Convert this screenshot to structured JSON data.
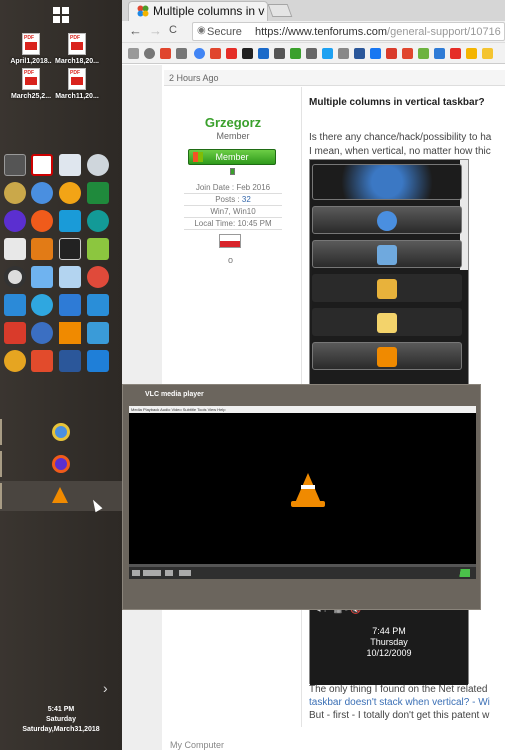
{
  "desktop": {
    "files": [
      {
        "label": "April1,2018..",
        "icon": "pdf-icon"
      },
      {
        "label": "March18,20...",
        "icon": "pdf-icon"
      },
      {
        "label": "March25,2...",
        "icon": "pdf-icon"
      },
      {
        "label": "March11,20...",
        "icon": "pdf-icon"
      }
    ]
  },
  "taskbar": {
    "clock_time": "5:41 PM",
    "clock_day": "Saturday",
    "clock_date": "Saturday,March31,2018",
    "expand_glyph": "›"
  },
  "browser": {
    "tab_title": "Multiple columns in vertical taskbar",
    "secure_label": "Secure",
    "url_host": "https://www.tenforums.com",
    "url_path": "/general-support/10716",
    "nav_back": "←",
    "nav_forward": "→",
    "nav_reload": "C",
    "nav_home": "⌂"
  },
  "post": {
    "time_ago": "2 Hours Ago",
    "user": {
      "name": "Grzegorz",
      "role": "Member",
      "badge": "Member",
      "join_date": "Join Date : Feb 2016",
      "posts_label": "Posts :",
      "posts_count": "32",
      "os": "Win7, Win10",
      "local_time": "Local Time: 10:45 PM",
      "dot": "o"
    },
    "title": "Multiple columns in vertical taskbar?",
    "line1": "Is there any chance/hack/possibility to ha",
    "line2": "I mean, when vertical, no matter how thic",
    "shot_time": "7:44 PM",
    "shot_day": "Thursday",
    "shot_date": "10/12/2009",
    "line3": "The only thing I found on the Net related",
    "line4_link": "taskbar doesn't stack when vertical? - Wi",
    "line5": "But - first - I totally don't get this patent w",
    "my_computer": "My Computer"
  },
  "vlc": {
    "title": "VLC media player",
    "menu": "Media  Playback  Audio  Video  Subtitle  Tools  View  Help"
  },
  "colors": {
    "accent_green": "#3aa02c",
    "vlc_orange": "#f08a00",
    "link_blue": "#3a6fb5"
  }
}
